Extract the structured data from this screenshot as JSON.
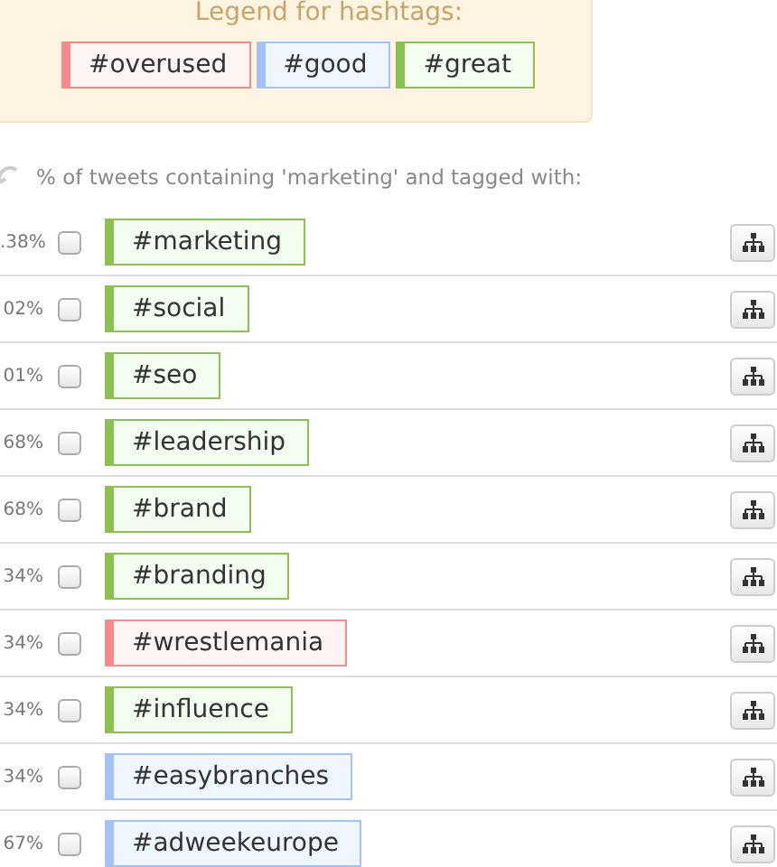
{
  "legend": {
    "title": "Legend for hashtags:",
    "items": [
      {
        "label": "#overused",
        "kind": "overused"
      },
      {
        "label": "#good",
        "kind": "good"
      },
      {
        "label": "#great",
        "kind": "great"
      }
    ]
  },
  "caption": "% of tweets containing 'marketing' and tagged with:",
  "rows": [
    {
      "percent": ".38%",
      "checked": false,
      "tag": "#marketing",
      "kind": "great"
    },
    {
      "percent": "02%",
      "checked": false,
      "tag": "#social",
      "kind": "great"
    },
    {
      "percent": "01%",
      "checked": false,
      "tag": "#seo",
      "kind": "great"
    },
    {
      "percent": "68%",
      "checked": false,
      "tag": "#leadership",
      "kind": "great"
    },
    {
      "percent": "68%",
      "checked": false,
      "tag": "#brand",
      "kind": "great"
    },
    {
      "percent": "34%",
      "checked": false,
      "tag": "#branding",
      "kind": "great"
    },
    {
      "percent": "34%",
      "checked": false,
      "tag": "#wrestlemania",
      "kind": "overused"
    },
    {
      "percent": "34%",
      "checked": false,
      "tag": "#influence",
      "kind": "great"
    },
    {
      "percent": "34%",
      "checked": false,
      "tag": "#easybranches",
      "kind": "good"
    },
    {
      "percent": "67%",
      "checked": false,
      "tag": "#adweekeurope",
      "kind": "good"
    }
  ]
}
